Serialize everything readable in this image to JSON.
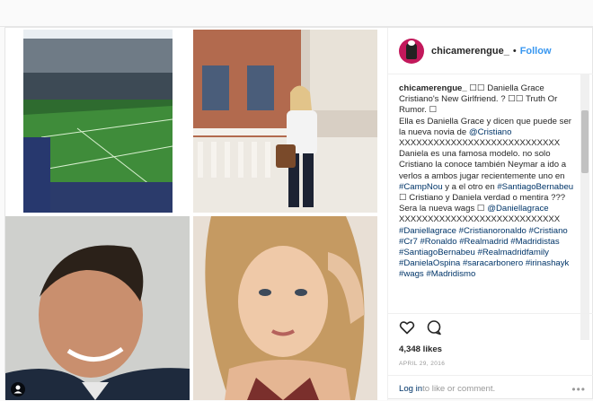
{
  "header": {
    "username": "chicamerengue_",
    "separator": "•",
    "follow_label": "Follow"
  },
  "caption": {
    "author": "chicamerengue_",
    "p1": "☐☐ Daniella Grace Cristiano's New Girlfriend. ? ☐☐ Truth Or Rumor. ☐",
    "p2a": "Ella es Daniella Grace y dicen que puede ser la nueva novia de ",
    "mention1": "@Cristiano",
    "xs1": "XXXXXXXXXXXXXXXXXXXXXXXXXXXX",
    "p3a": " Daniela es una famosa modelo. no solo Cristiano la conoce también Neymar a ido a verlos a ambos jugar recientemente uno en ",
    "tag_campnou": "#CampNou",
    "p3b": " y a el otro en ",
    "tag_bernabeu1": "#SantiagoBernabeu",
    "p3c": " ☐ Cristiano y Daniela verdad o mentira ??? Sera la nueva wags ☐ ",
    "mention2": "@Daniellagrace",
    "xs2": "XXXXXXXXXXXXXXXXXXXXXXXXXXXX",
    "tags": [
      "#Daniellagrace",
      "#Cristianoronaldo",
      "#Cristiano",
      "#Cr7",
      "#Ronaldo",
      "#Realmadrid",
      "#Madridistas",
      "#SantiagoBernabeu",
      "#Realmadridfamily",
      "#DanielaOspina",
      "#saracarbonero",
      "#irinashayk",
      "#wags",
      "#Madridismo"
    ]
  },
  "footer": {
    "likes": "4,348 likes",
    "date": "APRIL 29, 2016",
    "login_link": "Log in",
    "login_rest": " to like or comment.",
    "more": "•••"
  },
  "icons": {
    "like": "heart-icon",
    "comment": "comment-icon",
    "user_tag": "person-icon"
  },
  "colors": {
    "link": "#003569",
    "follow": "#3897f0",
    "muted": "#999999"
  }
}
